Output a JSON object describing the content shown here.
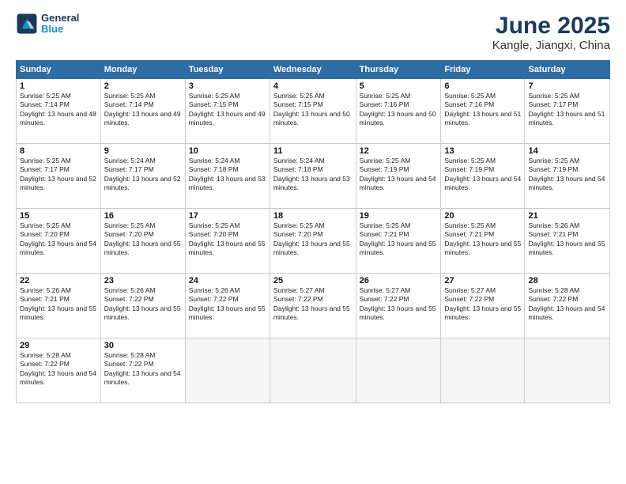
{
  "logo": {
    "line1": "General",
    "line2": "Blue"
  },
  "title": "June 2025",
  "subtitle": "Kangle, Jiangxi, China",
  "weekdays": [
    "Sunday",
    "Monday",
    "Tuesday",
    "Wednesday",
    "Thursday",
    "Friday",
    "Saturday"
  ],
  "weeks": [
    [
      {
        "day": "1",
        "sunrise": "5:25 AM",
        "sunset": "7:14 PM",
        "daylight": "13 hours and 48 minutes."
      },
      {
        "day": "2",
        "sunrise": "5:25 AM",
        "sunset": "7:14 PM",
        "daylight": "13 hours and 49 minutes."
      },
      {
        "day": "3",
        "sunrise": "5:25 AM",
        "sunset": "7:15 PM",
        "daylight": "13 hours and 49 minutes."
      },
      {
        "day": "4",
        "sunrise": "5:25 AM",
        "sunset": "7:15 PM",
        "daylight": "13 hours and 50 minutes."
      },
      {
        "day": "5",
        "sunrise": "5:25 AM",
        "sunset": "7:16 PM",
        "daylight": "13 hours and 50 minutes."
      },
      {
        "day": "6",
        "sunrise": "5:25 AM",
        "sunset": "7:16 PM",
        "daylight": "13 hours and 51 minutes."
      },
      {
        "day": "7",
        "sunrise": "5:25 AM",
        "sunset": "7:17 PM",
        "daylight": "13 hours and 51 minutes."
      }
    ],
    [
      {
        "day": "8",
        "sunrise": "5:25 AM",
        "sunset": "7:17 PM",
        "daylight": "13 hours and 52 minutes."
      },
      {
        "day": "9",
        "sunrise": "5:24 AM",
        "sunset": "7:17 PM",
        "daylight": "13 hours and 52 minutes."
      },
      {
        "day": "10",
        "sunrise": "5:24 AM",
        "sunset": "7:18 PM",
        "daylight": "13 hours and 53 minutes."
      },
      {
        "day": "11",
        "sunrise": "5:24 AM",
        "sunset": "7:18 PM",
        "daylight": "13 hours and 53 minutes."
      },
      {
        "day": "12",
        "sunrise": "5:25 AM",
        "sunset": "7:19 PM",
        "daylight": "13 hours and 54 minutes."
      },
      {
        "day": "13",
        "sunrise": "5:25 AM",
        "sunset": "7:19 PM",
        "daylight": "13 hours and 54 minutes."
      },
      {
        "day": "14",
        "sunrise": "5:25 AM",
        "sunset": "7:19 PM",
        "daylight": "13 hours and 54 minutes."
      }
    ],
    [
      {
        "day": "15",
        "sunrise": "5:25 AM",
        "sunset": "7:20 PM",
        "daylight": "13 hours and 54 minutes."
      },
      {
        "day": "16",
        "sunrise": "5:25 AM",
        "sunset": "7:20 PM",
        "daylight": "13 hours and 55 minutes."
      },
      {
        "day": "17",
        "sunrise": "5:25 AM",
        "sunset": "7:20 PM",
        "daylight": "13 hours and 55 minutes."
      },
      {
        "day": "18",
        "sunrise": "5:25 AM",
        "sunset": "7:20 PM",
        "daylight": "13 hours and 55 minutes."
      },
      {
        "day": "19",
        "sunrise": "5:25 AM",
        "sunset": "7:21 PM",
        "daylight": "13 hours and 55 minutes."
      },
      {
        "day": "20",
        "sunrise": "5:25 AM",
        "sunset": "7:21 PM",
        "daylight": "13 hours and 55 minutes."
      },
      {
        "day": "21",
        "sunrise": "5:26 AM",
        "sunset": "7:21 PM",
        "daylight": "13 hours and 55 minutes."
      }
    ],
    [
      {
        "day": "22",
        "sunrise": "5:26 AM",
        "sunset": "7:21 PM",
        "daylight": "13 hours and 55 minutes."
      },
      {
        "day": "23",
        "sunrise": "5:26 AM",
        "sunset": "7:22 PM",
        "daylight": "13 hours and 55 minutes."
      },
      {
        "day": "24",
        "sunrise": "5:26 AM",
        "sunset": "7:22 PM",
        "daylight": "13 hours and 55 minutes."
      },
      {
        "day": "25",
        "sunrise": "5:27 AM",
        "sunset": "7:22 PM",
        "daylight": "13 hours and 55 minutes."
      },
      {
        "day": "26",
        "sunrise": "5:27 AM",
        "sunset": "7:22 PM",
        "daylight": "13 hours and 55 minutes."
      },
      {
        "day": "27",
        "sunrise": "5:27 AM",
        "sunset": "7:22 PM",
        "daylight": "13 hours and 55 minutes."
      },
      {
        "day": "28",
        "sunrise": "5:28 AM",
        "sunset": "7:22 PM",
        "daylight": "13 hours and 54 minutes."
      }
    ],
    [
      {
        "day": "29",
        "sunrise": "5:28 AM",
        "sunset": "7:22 PM",
        "daylight": "13 hours and 54 minutes."
      },
      {
        "day": "30",
        "sunrise": "5:28 AM",
        "sunset": "7:22 PM",
        "daylight": "13 hours and 54 minutes."
      },
      null,
      null,
      null,
      null,
      null
    ]
  ]
}
